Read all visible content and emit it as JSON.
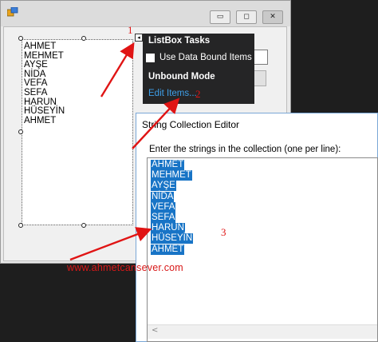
{
  "form": {
    "window_buttons": {
      "minimize": "▭",
      "maximize": "◻",
      "close": "✕"
    },
    "listbox_items": [
      "AHMET",
      "MEHMET",
      "AYŞE",
      "NİDA",
      "VEFA",
      "SEFA",
      "HARUN",
      "HÜSEYİN",
      "AHMET"
    ],
    "smart_tag_glyph": "◂"
  },
  "tasks_panel": {
    "title": "ListBox Tasks",
    "checkbox_label": "Use Data Bound Items",
    "checkbox_checked": false,
    "section_header": "Unbound Mode",
    "edit_items_link": "Edit Items..."
  },
  "editor": {
    "title": "String Collection Editor",
    "prompt": "Enter the strings in the collection (one per line):",
    "lines": [
      "AHMET",
      "MEHMET",
      "AYŞE",
      "NİDA",
      "VEFA",
      "SEFA",
      "HARUN",
      "HÜSEYİN",
      "AHMET"
    ],
    "scroll_left_glyph": "<"
  },
  "annotations": {
    "step1": "1",
    "step2": "2",
    "step3": "3",
    "watermark": "www.ahmetcansever.com"
  },
  "colors": {
    "annotation_red": "#e01414",
    "selection_blue": "#1874c6",
    "link_blue": "#3e9fe8",
    "panel_dark": "#252526"
  },
  "icons": {
    "app": "form-app-icon",
    "arrow": "red-arrow-icon"
  }
}
